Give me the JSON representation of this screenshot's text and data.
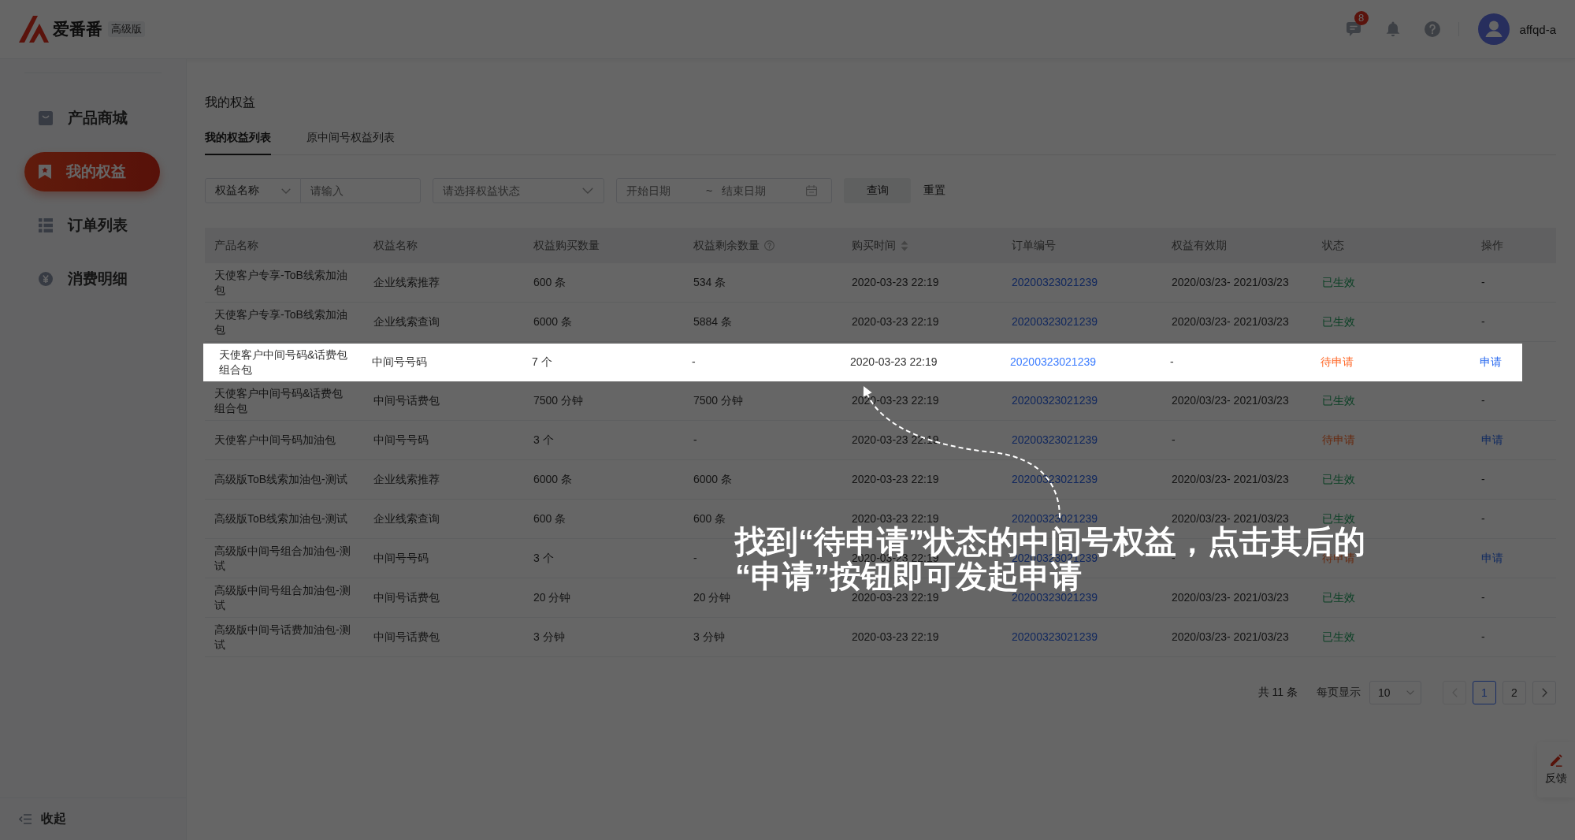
{
  "header": {
    "brand": "爱番番",
    "edition": "高级版",
    "message_count": "8",
    "username": "affqd-a"
  },
  "sidebar": {
    "items": [
      {
        "label": "产品商城",
        "selected": false
      },
      {
        "label": "我的权益",
        "selected": true
      },
      {
        "label": "订单列表",
        "selected": false
      },
      {
        "label": "消费明细",
        "selected": false
      }
    ],
    "collapse_label": "收起"
  },
  "page": {
    "title": "我的权益",
    "tabs": [
      {
        "label": "我的权益列表",
        "selected": true
      },
      {
        "label": "原中间号权益列表",
        "selected": false
      }
    ]
  },
  "filters": {
    "field_select": "权益名称",
    "keyword": {
      "placeholder": "请输入"
    },
    "status": {
      "placeholder": "请选择权益状态"
    },
    "date_range": {
      "start": {
        "placeholder": "开始日期"
      },
      "separator": "~",
      "end": {
        "placeholder": "结束日期"
      }
    },
    "buttons": [
      {
        "label": "查询",
        "kind": "filled"
      },
      {
        "label": "重置",
        "kind": "plain"
      }
    ]
  },
  "table": {
    "columns": [
      {
        "label": "产品名称",
        "kind": "plain"
      },
      {
        "label": "权益名称",
        "kind": "plain"
      },
      {
        "label": "权益购买数量",
        "kind": "plain"
      },
      {
        "label": "权益剩余数量",
        "kind": "help"
      },
      {
        "label": "购买时间",
        "kind": "sortable"
      },
      {
        "label": "订单编号",
        "kind": "plain"
      },
      {
        "label": "权益有效期",
        "kind": "plain"
      },
      {
        "label": "状态",
        "kind": "plain"
      },
      {
        "label": "操作",
        "kind": "plain"
      }
    ],
    "rows": [
      {
        "product": "天使客户专享-ToB线索加油包",
        "benefit": "企业线索推荐",
        "purchased": "600 条",
        "remaining": "534 条",
        "purchase_time": "2020-03-23 22:19",
        "order_no": "20200323021239",
        "validity": "2020/03/23- 2021/03/23",
        "status": {
          "text": "已生效",
          "kind": "active"
        },
        "action": {
          "text": "-",
          "kind": "none"
        },
        "highlighted": false
      },
      {
        "product": "天使客户专享-ToB线索加油包",
        "benefit": "企业线索查询",
        "purchased": "6000 条",
        "remaining": "5884 条",
        "purchase_time": "2020-03-23 22:19",
        "order_no": "20200323021239",
        "validity": "2020/03/23- 2021/03/23",
        "status": {
          "text": "已生效",
          "kind": "active"
        },
        "action": {
          "text": "-",
          "kind": "none"
        },
        "highlighted": false
      },
      {
        "product": "天使客户中间号码&话费包组合包",
        "benefit": "中间号号码",
        "purchased": "7 个",
        "remaining": "-",
        "purchase_time": "2020-03-23 22:19",
        "order_no": "20200323021239",
        "validity": "-",
        "status": {
          "text": "待申请",
          "kind": "pending"
        },
        "action": {
          "text": "申请",
          "kind": "link"
        },
        "highlighted": true
      },
      {
        "product": "天使客户中间号码&话费包组合包",
        "benefit": "中间号话费包",
        "purchased": "7500 分钟",
        "remaining": "7500 分钟",
        "purchase_time": "2020-03-23 22:19",
        "order_no": "20200323021239",
        "validity": "2020/03/23- 2021/03/23",
        "status": {
          "text": "已生效",
          "kind": "active"
        },
        "action": {
          "text": "-",
          "kind": "none"
        },
        "highlighted": false
      },
      {
        "product": "天使客户中间号码加油包",
        "benefit": "中间号号码",
        "purchased": "3 个",
        "remaining": "-",
        "purchase_time": "2020-03-23 22:19",
        "order_no": "20200323021239",
        "validity": "-",
        "status": {
          "text": "待申请",
          "kind": "pending"
        },
        "action": {
          "text": "申请",
          "kind": "link"
        },
        "highlighted": false
      },
      {
        "product": "高级版ToB线索加油包-测试",
        "benefit": "企业线索推荐",
        "purchased": "6000 条",
        "remaining": "6000 条",
        "purchase_time": "2020-03-23 22:19",
        "order_no": "20200323021239",
        "validity": "2020/03/23- 2021/03/23",
        "status": {
          "text": "已生效",
          "kind": "active"
        },
        "action": {
          "text": "-",
          "kind": "none"
        },
        "highlighted": false
      },
      {
        "product": "高级版ToB线索加油包-测试",
        "benefit": "企业线索查询",
        "purchased": "600 条",
        "remaining": "600 条",
        "purchase_time": "2020-03-23 22:19",
        "order_no": "20200323021239",
        "validity": "2020/03/23- 2021/03/23",
        "status": {
          "text": "已生效",
          "kind": "active"
        },
        "action": {
          "text": "-",
          "kind": "none"
        },
        "highlighted": false
      },
      {
        "product": "高级版中间号组合加油包-测试",
        "benefit": "中间号号码",
        "purchased": "3 个",
        "remaining": "-",
        "purchase_time": "2020-03-23 22:19",
        "order_no": "20200323021239",
        "validity": "-",
        "status": {
          "text": "待申请",
          "kind": "pending"
        },
        "action": {
          "text": "申请",
          "kind": "link"
        },
        "highlighted": false
      },
      {
        "product": "高级版中间号组合加油包-测试",
        "benefit": "中间号话费包",
        "purchased": "20 分钟",
        "remaining": "20 分钟",
        "purchase_time": "2020-03-23 22:19",
        "order_no": "20200323021239",
        "validity": "2020/03/23- 2021/03/23",
        "status": {
          "text": "已生效",
          "kind": "active"
        },
        "action": {
          "text": "-",
          "kind": "none"
        },
        "highlighted": false
      },
      {
        "product": "高级版中间号话费加油包-测试",
        "benefit": "中间号话费包",
        "purchased": "3 分钟",
        "remaining": "3 分钟",
        "purchase_time": "2020-03-23 22:19",
        "order_no": "20200323021239",
        "validity": "2020/03/23- 2021/03/23",
        "status": {
          "text": "已生效",
          "kind": "active"
        },
        "action": {
          "text": "-",
          "kind": "none"
        },
        "highlighted": false
      }
    ]
  },
  "pagination": {
    "total": "共 11 条",
    "page_size_label": "每页显示",
    "page_size": "10",
    "previous": {
      "disabled": true
    },
    "pages": [
      {
        "label": "1",
        "selected": true
      },
      {
        "label": "2",
        "selected": false
      }
    ],
    "next": {
      "disabled": false
    }
  },
  "feedback": {
    "label": "反馈"
  },
  "guide": {
    "caption_lines": [
      "找到“待申请”状态的中间号权益，点击其后的",
      "“申请”按钮即可发起申请"
    ]
  }
}
